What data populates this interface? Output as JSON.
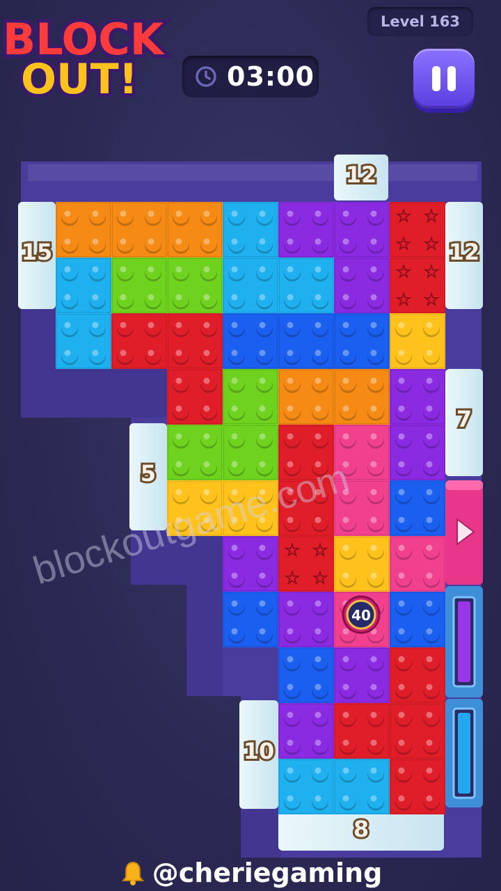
{
  "header": {
    "logo_line1": "BLOCK",
    "logo_line2": "OUT!",
    "level_label": "Level 163",
    "timer": "03:00"
  },
  "exits": {
    "top": "12",
    "left": "15",
    "right_top": "12",
    "right_mid": "7",
    "left_mid": "5",
    "left_bottom": "10",
    "bottom": "8"
  },
  "special_block": {
    "counter": "40"
  },
  "watermark": "blockoutgame.com",
  "credit": "@cheriegaming",
  "colors": {
    "orange": "#f58a14",
    "green": "#6ed21e",
    "cyan": "#1fb0f0",
    "purple": "#8a2be2",
    "red": "#e01e2a",
    "blue": "#1a5ff0",
    "yellow": "#ffc21c",
    "pink": "#f0408e",
    "board": "#4a3c9c",
    "exit": "#d9eef6"
  },
  "icons": [
    "clock-icon",
    "pause-icon",
    "arrow-right-icon",
    "bell-icon",
    "star-icon"
  ]
}
